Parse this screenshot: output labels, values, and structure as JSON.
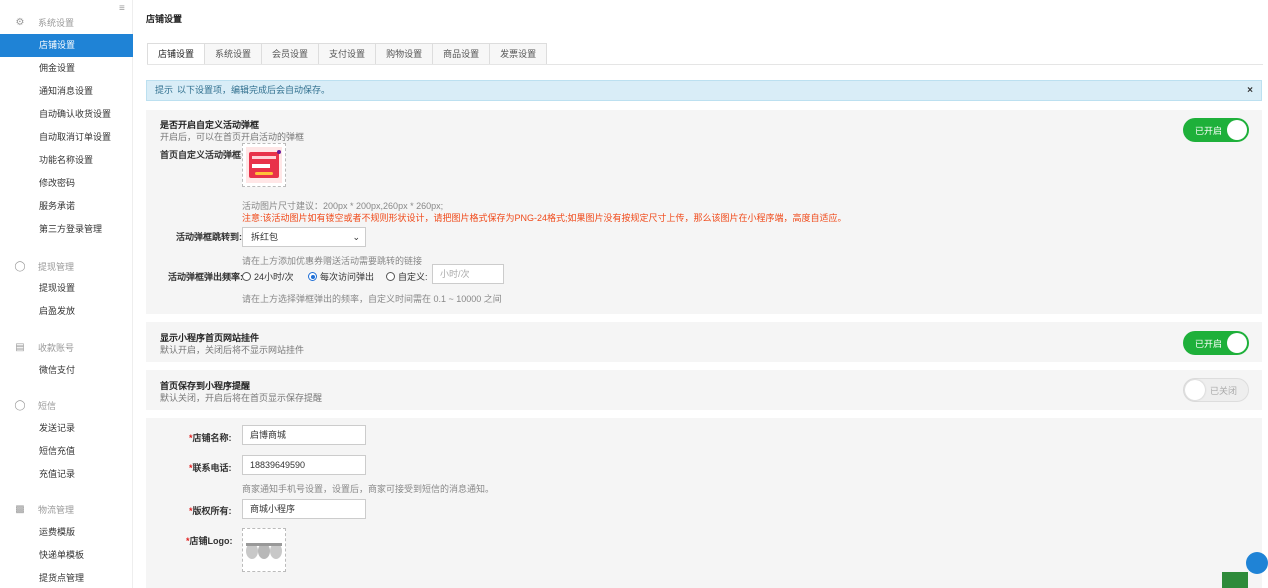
{
  "sidebar": {
    "groups": [
      {
        "icon": "gear-icon",
        "label": "系统设置",
        "items": [
          "店铺设置",
          "佣金设置",
          "通知消息设置",
          "自动确认收货设置",
          "自动取消订单设置",
          "功能名称设置",
          "修改密码",
          "服务承诺",
          "第三方登录管理"
        ]
      },
      {
        "icon": "withdraw-icon",
        "label": "提现管理",
        "items": [
          "提现设置",
          "启盈发放"
        ]
      },
      {
        "icon": "card-icon",
        "label": "收款账号",
        "items": [
          "微信支付"
        ]
      },
      {
        "icon": "sms-icon",
        "label": "短信",
        "items": [
          "发送记录",
          "短信充值",
          "充值记录"
        ]
      },
      {
        "icon": "truck-icon",
        "label": "物流管理",
        "items": [
          "运费模版",
          "快递单模板",
          "提货点管理"
        ]
      }
    ],
    "active": "店铺设置"
  },
  "page": {
    "title": "店铺设置"
  },
  "tabs": [
    "店铺设置",
    "系统设置",
    "会员设置",
    "支付设置",
    "购物设置",
    "商品设置",
    "发票设置"
  ],
  "tip": {
    "strong": "提示",
    "text": "以下设置项，编辑完成后会自动保存。",
    "close": "×"
  },
  "popup": {
    "title": "是否开启自定义活动弹框",
    "subtitle": "开启后，可以在首页开启活动的弹框",
    "toggle": "已开启",
    "img_label": "首页自定义活动弹框:",
    "size_note": "活动图片尺寸建议：200px * 200px,260px * 260px;",
    "warn_note": "注意:该活动图片如有镂空或者不规则形状设计，请把图片格式保存为PNG-24格式;如果图片没有按规定尺寸上传，那么该图片在小程序端，高度自适应。",
    "jump_label": "活动弹框跳转到:",
    "jump_value": "拆红包",
    "jump_note": "请在上方添加优惠券赠送活动需要跳转的链接",
    "freq_label": "活动弹框弹出频率:",
    "freq_options": [
      "24小时/次",
      "每次访问弹出",
      "自定义:"
    ],
    "freq_selected": 1,
    "freq_placeholder": "小时/次",
    "freq_note": "请在上方选择弹框弹出的频率，自定义时间需在 0.1 ~ 10000 之间"
  },
  "plugin": {
    "title": "显示小程序首页网站挂件",
    "subtitle": "默认开启，关闭后将不显示网站挂件",
    "toggle": "已开启"
  },
  "save": {
    "title": "首页保存到小程序提醒",
    "subtitle": "默认关闭，开启后将在首页显示保存提醒",
    "toggle": "已关闭"
  },
  "shop": {
    "name_label": "店铺名称:",
    "name_value": "启博商城",
    "phone_label": "联系电话:",
    "phone_value": "18839649590",
    "phone_note": "商家通知手机号设置，设置后，商家可接受到短信的消息通知。",
    "copyright_label": "版权所有:",
    "copyright_value": "商城小程序",
    "logo_label": "店铺Logo:",
    "req_mark": "*"
  },
  "colors": {
    "primary": "#1f83d6",
    "toggle_on": "#1eb03a",
    "warn": "#f04a1a",
    "tip_bg": "#d9edf7"
  }
}
